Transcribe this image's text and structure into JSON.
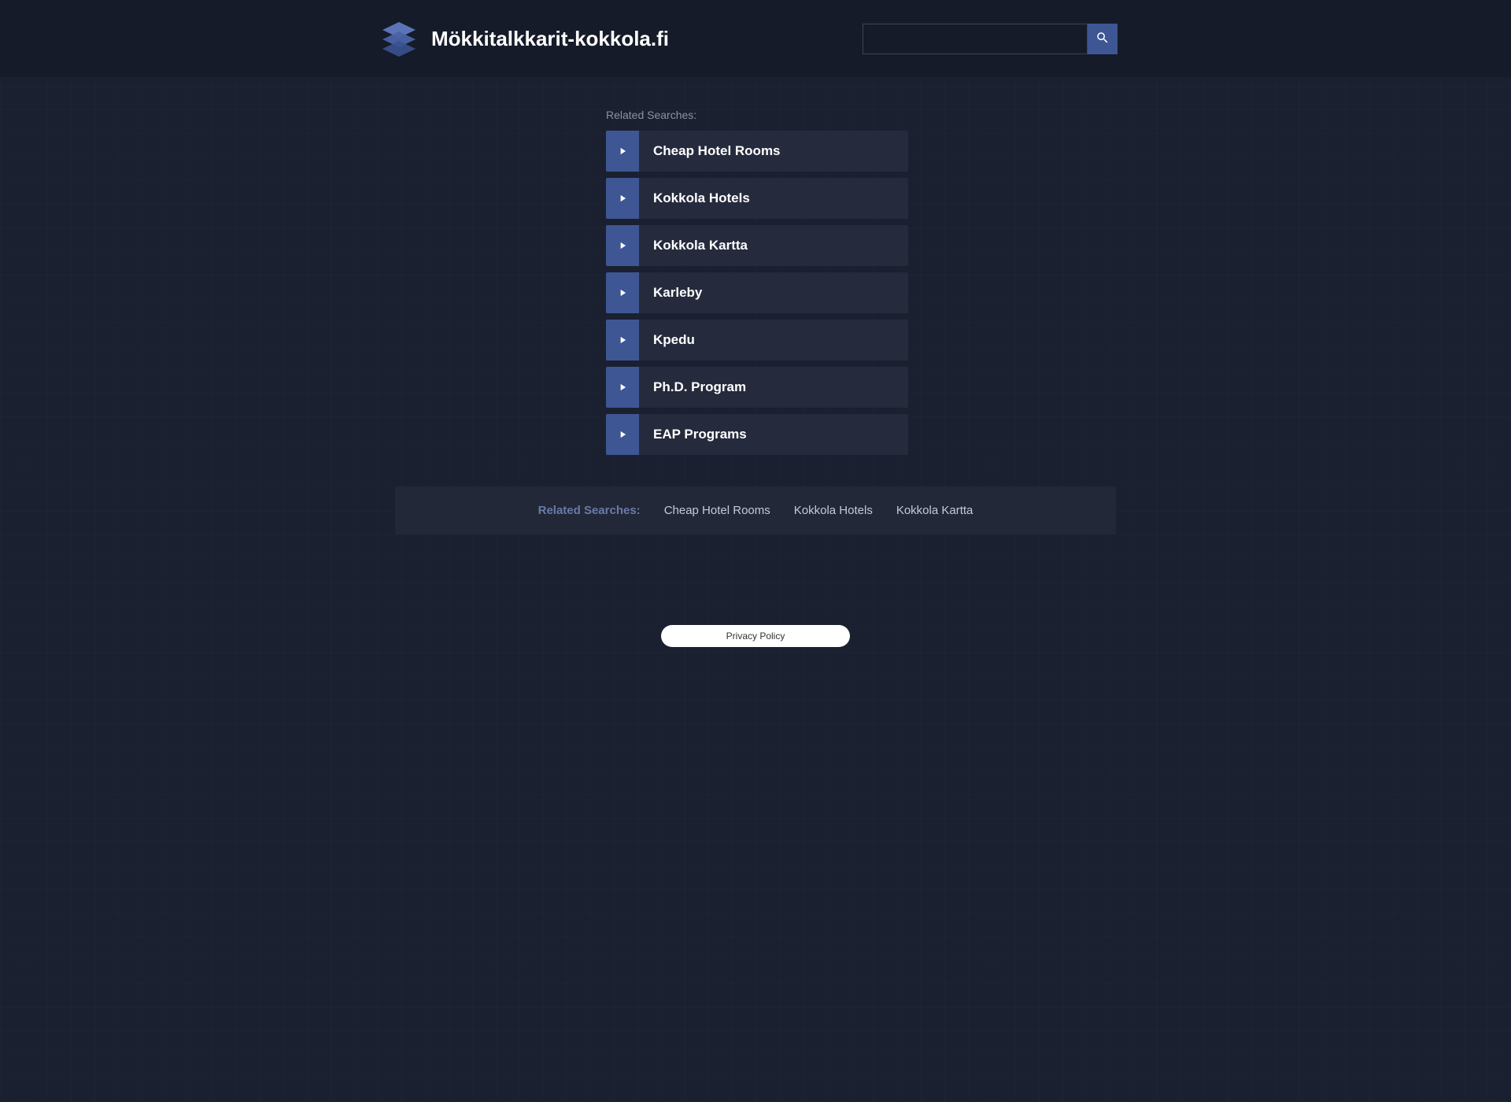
{
  "header": {
    "title": "Mökkitalkkarit-kokkola.fi",
    "search_value": ""
  },
  "related": {
    "label": "Related Searches:",
    "items": [
      {
        "label": "Cheap Hotel Rooms"
      },
      {
        "label": "Kokkola Hotels"
      },
      {
        "label": "Kokkola Kartta"
      },
      {
        "label": "Karleby"
      },
      {
        "label": "Kpedu"
      },
      {
        "label": "Ph.D. Program"
      },
      {
        "label": "EAP Programs"
      }
    ]
  },
  "footer": {
    "label": "Related Searches:",
    "links": [
      {
        "label": "Cheap Hotel Rooms"
      },
      {
        "label": "Kokkola Hotels"
      },
      {
        "label": "Kokkola Kartta"
      }
    ]
  },
  "privacy": {
    "label": "Privacy Policy"
  }
}
